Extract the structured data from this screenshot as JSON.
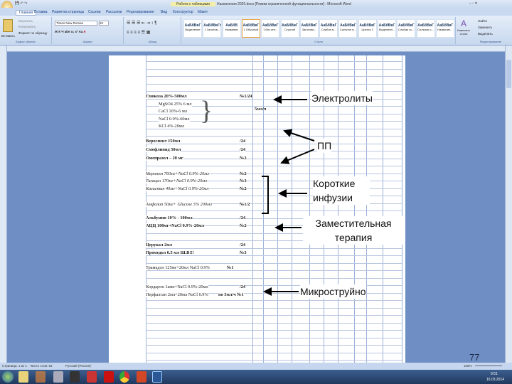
{
  "window": {
    "title": "Назначения 2020.docx [Режим ограниченной функциональности] - Microsoft Word",
    "hint": "Работа с таблицами"
  },
  "tabs": [
    "Главная",
    "Вставка",
    "Разметка страницы",
    "Ссылки",
    "Рассылки",
    "Рецензирование",
    "Вид",
    "Конструктор",
    "Макет"
  ],
  "ribbon": {
    "paste": "Вставить",
    "cut": "Вырезать",
    "copy": "Копировать",
    "format_painter": "Формат по образцу",
    "clipboard": "Буфер обмена",
    "font_name": "Times New Roman",
    "font_size": "10",
    "font_group": "Шрифт",
    "paragraph_group": "Абзац",
    "styles_group": "Стили",
    "change_styles": "Изменить стили",
    "find": "Найти",
    "replace": "Заменить",
    "select": "Выделить",
    "editing_group": "Редактирование",
    "styles": [
      {
        "sample": "АаБбВвГ",
        "name": "Выделение"
      },
      {
        "sample": "АаБбВвГг",
        "name": "1 Заголов..."
      },
      {
        "sample": "АаБбВ",
        "name": "Название"
      },
      {
        "sample": "АаБбВвГ",
        "name": "1 Обычный"
      },
      {
        "sample": "АаБбВвГ",
        "name": "1 Без инт..."
      },
      {
        "sample": "АаБбВвГ",
        "name": "Строгий"
      },
      {
        "sample": "АаБбВвГ",
        "name": "Заголово..."
      },
      {
        "sample": "АаБбВвГ",
        "name": "Слабое в..."
      },
      {
        "sample": "АаБбВвГ",
        "name": "Сильное в..."
      },
      {
        "sample": "АаБбВвГ",
        "name": "Цитата 2"
      },
      {
        "sample": "АаБбВвГ",
        "name": "Выделенн..."
      },
      {
        "sample": "АаБбВвГ",
        "name": "Слабая сс..."
      },
      {
        "sample": "АаБбВвГ",
        "name": "Сильная с..."
      },
      {
        "sample": "АаБбВвГ",
        "name": "Название..."
      }
    ]
  },
  "document": {
    "lines": [
      {
        "text": "Глюкоза 20%-500мл",
        "note": "№1/24",
        "bold": true
      },
      {
        "text": "MgSO4 25% 6 мл"
      },
      {
        "text": "CaCl 10%-6 мл"
      },
      {
        "text": "NaCl 0.9%-60мл"
      },
      {
        "text": "KCl 4%-20мл"
      },
      {
        "text": "Вероспект 150мл",
        "note": "/24",
        "bold": true
      },
      {
        "text": "Смофлипид 50мл",
        "note": "/24",
        "bold": true
      },
      {
        "text": "Омепразол – 20 мг",
        "note": "№2",
        "bold": true
      },
      {
        "text": "Меронем 760мг+NaCl 0.9%-20мл",
        "note": "№2",
        "italic": true
      },
      {
        "text": "Тигацил 170мг+NaCl 0.9%-20мл",
        "note": "№3",
        "italic": true
      },
      {
        "text": "Колистин 40мг+NaCl 0.9%-20мл",
        "note": "№2",
        "italic": true
      },
      {
        "text": "Амфолип 50мг+ Glucose 5% 200мл",
        "note": "№1/2",
        "italic": true
      },
      {
        "text": "Альбумин 10% - 100мл",
        "note": "/24",
        "bold": true
      },
      {
        "text": "АЦЦ 100мг+NaCl 0.9%-20мл",
        "note": "№2",
        "bold": true
      },
      {
        "text": "Церукал 2мл",
        "note": "/24",
        "bold": true
      },
      {
        "text": "Промедол 0.5 мл      Ш.В!!!",
        "note": "№3",
        "bold": true
      },
      {
        "text": "Трамадол 125мг+20мл NaCl 0.9%",
        "note": "№1"
      },
      {
        "text": "Кордарон 1амп+NaCl 0.9%-20мл",
        "note": "/24"
      },
      {
        "text": "Перфалган 2мл+20мл NaCl 0.9%",
        "note": "по 5мл/ч №1"
      }
    ],
    "side_note": "5мл/ч"
  },
  "annotations": {
    "electrolytes": "Электролиты",
    "pp": "ПП",
    "short_infusions": "Короткие инфузии",
    "replacement": "Заместительная терапия",
    "micro": "Микроструйно"
  },
  "slide_number": "77",
  "status": {
    "page": "Страница: 1 из 1",
    "words": "Число слов: 62",
    "lang": "Русский (Россия)",
    "zoom": "105%"
  },
  "tray": {
    "time": "9:51",
    "date": "16.03.2014"
  }
}
